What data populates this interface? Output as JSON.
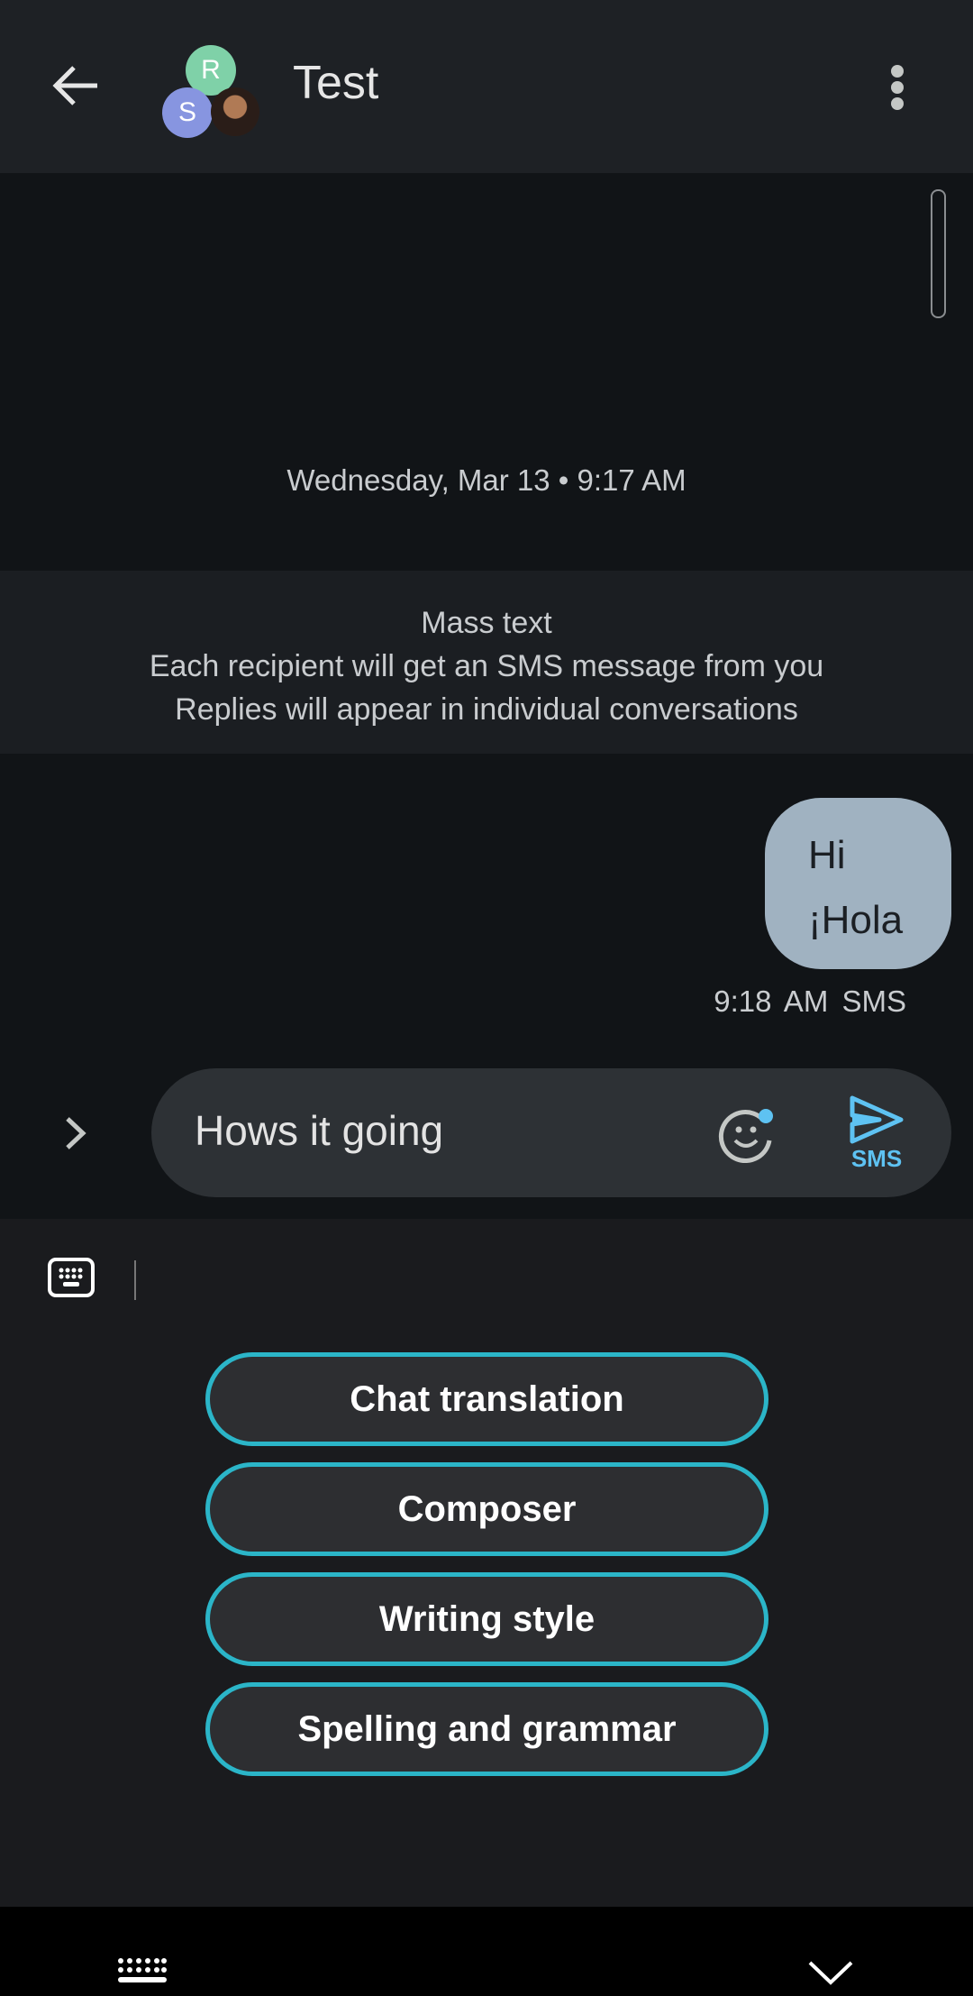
{
  "header": {
    "title": "Test",
    "avatars": [
      {
        "initial": "R",
        "color": "#7fd1a8"
      },
      {
        "initial": "S",
        "color": "#8795e0"
      }
    ]
  },
  "conversation": {
    "date": "Wednesday, Mar 13 • 9:17 AM",
    "mass_text": {
      "title": "Mass text",
      "line1": "Each recipient will get an SMS message from you",
      "line2": "Replies will appear in individual conversations"
    },
    "message": {
      "line1": "Hi",
      "line2": "¡Hola",
      "time": "9:18 AM",
      "type": "SMS"
    }
  },
  "composer": {
    "value": "Hows it going",
    "send_label": "SMS"
  },
  "keyboard": {
    "options": [
      "Chat translation",
      "Composer",
      "Writing style",
      "Spelling and grammar"
    ]
  },
  "colors": {
    "accent": "#2bb5c8",
    "send": "#5ec2f2",
    "bubble": "#a0b2c1"
  }
}
